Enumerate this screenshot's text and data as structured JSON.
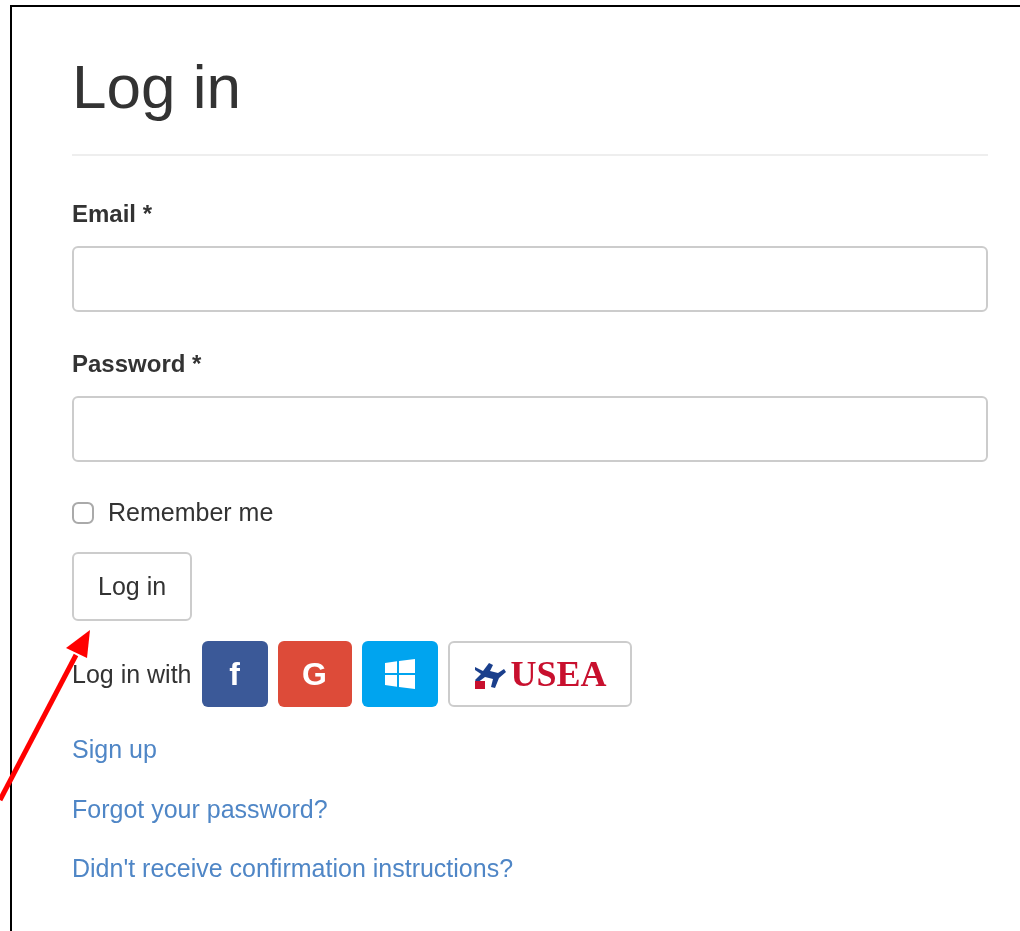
{
  "title": "Log in",
  "fields": [
    {
      "label": "Email *"
    },
    {
      "label": "Password *"
    }
  ],
  "remember": {
    "label": "Remember me",
    "checked": false
  },
  "submit": {
    "label": "Log in"
  },
  "external": {
    "label": "Log in with",
    "providers": [
      {
        "kind": "facebook",
        "glyph": "f"
      },
      {
        "kind": "google",
        "glyph": "G"
      },
      {
        "kind": "windows"
      },
      {
        "kind": "usea",
        "text": "USEA"
      }
    ]
  },
  "links": [
    "Sign up",
    "Forgot your password?",
    "Didn't receive confirmation instructions?"
  ]
}
